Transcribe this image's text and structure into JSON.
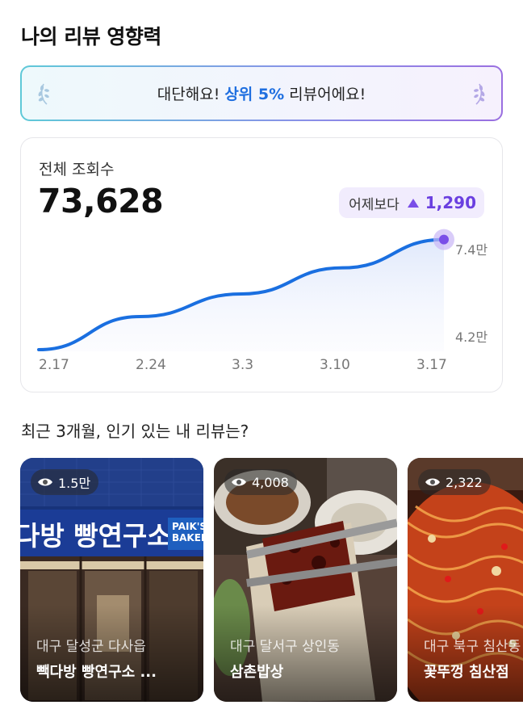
{
  "header": {
    "title": "나의 리뷰 영향력"
  },
  "banner": {
    "prefix": "대단해요!",
    "highlight": "상위 5%",
    "suffix": "리뷰어에요!"
  },
  "views_card": {
    "label": "전체 조회수",
    "total": "73,628",
    "delta_label": "어제보다",
    "delta_value": "1,290",
    "y_labels": {
      "top": "7.4만",
      "bottom": "4.2만"
    },
    "x_labels": [
      "2.17",
      "2.24",
      "3.3",
      "3.10",
      "3.17"
    ]
  },
  "chart_data": {
    "type": "area",
    "x": [
      "2.17",
      "2.24",
      "3.3",
      "3.10",
      "3.17"
    ],
    "series": [
      {
        "values": [
          42000,
          51500,
          58000,
          65500,
          73628
        ]
      }
    ],
    "y_ticks": [
      "4.2만",
      "7.4만"
    ],
    "ylim": [
      42000,
      74000
    ],
    "colors": {
      "line": "#1a6fe0",
      "fill": "#e8eefc",
      "endpoint": "#7a4ee8"
    }
  },
  "popular": {
    "title": "최근 3개월, 인기 있는 내 리뷰는?",
    "items": [
      {
        "views": "1.5만",
        "location": "대구 달성군 다사읍",
        "name": "빽다방 빵연구소 ...",
        "sign_text": "다방 빵연구소",
        "sign_brand": "PAIK'S BAKER"
      },
      {
        "views": "4,008",
        "location": "대구 달서구 상인동",
        "name": "삼촌밥상"
      },
      {
        "views": "2,322",
        "location": "대구 북구 침산동",
        "name": "꽃뚜껑 침산점"
      }
    ]
  }
}
